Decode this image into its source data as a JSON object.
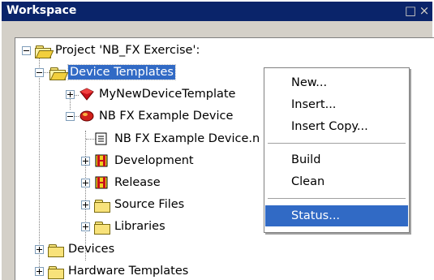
{
  "panel": {
    "title": "Workspace",
    "close_glyph": "□ ×"
  },
  "tree": {
    "root_label": "Project 'NB_FX Exercise':",
    "device_templates_label": "Device Templates",
    "my_template_label": "MyNewDeviceTemplate",
    "example_device_label": "NB FX Example Device",
    "example_file_label": "NB FX Example Device.n",
    "development_label": "Development",
    "release_label": "Release",
    "source_files_label": "Source Files",
    "libraries_label": "Libraries",
    "devices_label": "Devices",
    "hardware_templates_label": "Hardware Templates"
  },
  "context_menu": {
    "items": [
      "New...",
      "Insert...",
      "Insert Copy...",
      "Build",
      "Clean",
      "Status..."
    ],
    "highlighted": "Status..."
  },
  "colors": {
    "selection": "#316ac5",
    "titlebar": "#0a246a"
  }
}
